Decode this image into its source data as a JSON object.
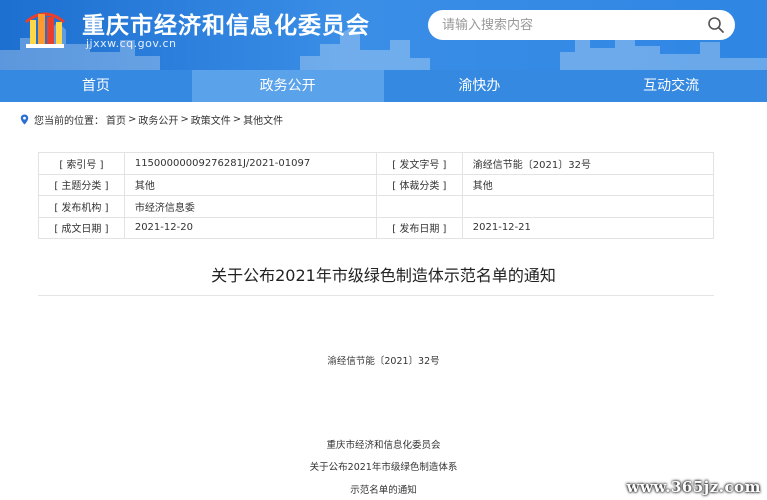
{
  "header": {
    "site_title": "重庆市经济和信息化委员会",
    "site_url": "jjxxw.cq.gov.cn",
    "search_placeholder": "请输入搜索内容",
    "colors": {
      "header_bg": "#2f86e3",
      "nav_bg": "#3689e0",
      "nav_active": "#5aa2ea"
    }
  },
  "nav": {
    "items": [
      {
        "label": "首页"
      },
      {
        "label": "政务公开",
        "active": true
      },
      {
        "label": "渝快办"
      },
      {
        "label": "互动交流"
      }
    ]
  },
  "breadcrumb": {
    "prefix": "您当前的位置：",
    "items": [
      "首页",
      "政务公开",
      "政策文件",
      "其他文件"
    ],
    "separator": ">"
  },
  "meta": {
    "rows": [
      {
        "k1": "[ 索引号 ]",
        "v1": "11500000009276281J/2021-01097",
        "k2": "[ 发文字号 ]",
        "v2": "渝经信节能〔2021〕32号"
      },
      {
        "k1": "[ 主题分类 ]",
        "v1": "其他",
        "k2": "[ 体裁分类 ]",
        "v2": "其他"
      },
      {
        "k1": "[ 发布机构 ]",
        "v1": "市经济信息委",
        "k2": "",
        "v2": ""
      },
      {
        "k1": "[ 成文日期 ]",
        "v1": "2021-12-20",
        "k2": "[ 发布日期 ]",
        "v2": "2021-12-21"
      }
    ]
  },
  "document": {
    "title": "关于公布2021年市级绿色制造体示范名单的通知",
    "doc_number": "渝经信节能〔2021〕32号",
    "body_lines": [
      "重庆市经济和信息化委员会",
      "关于公布2021年市级绿色制造体系",
      "示范名单的通知"
    ]
  },
  "watermark": "www.365jz.com"
}
